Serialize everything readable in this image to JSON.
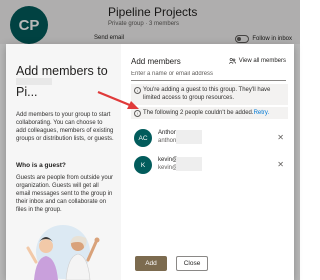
{
  "background": {
    "avatar_initials": "CP",
    "group_title": "Pipeline Projects",
    "privacy": "Private group · 3 members",
    "send_email": "Send email",
    "follow": "Follow in inbox"
  },
  "dialog": {
    "left": {
      "title_line1": "Add members to",
      "title_line2_suffix": "Pi...",
      "description": "Add members to your group to start collaborating. You can choose to add colleagues, members of existing groups or distribution lists, or guests.",
      "guest_heading": "Who is a guest?",
      "guest_text": "Guests are people from outside your organization. Guests will get all email messages sent to the group in their inbox and can collaborate on files in the group."
    },
    "right": {
      "title": "Add members",
      "view_all": "View all members",
      "search_placeholder": "Enter a name or email address",
      "notice_guest": "You're adding a guest to this group. They'll have limited access to group resources.",
      "notice_failed": "The following 2 people couldn't be added.",
      "retry": "Retry.",
      "members": [
        {
          "initials": "AC",
          "name": "Anthony",
          "email": "anthony@"
        },
        {
          "initials": "K",
          "name": "kevin@",
          "email": "kevin@"
        }
      ]
    },
    "footer": {
      "add": "Add",
      "close": "Close"
    }
  },
  "colors": {
    "accent": "#025c5c",
    "add_button": "#7c6b4f",
    "arrow": "#e03a3a"
  }
}
